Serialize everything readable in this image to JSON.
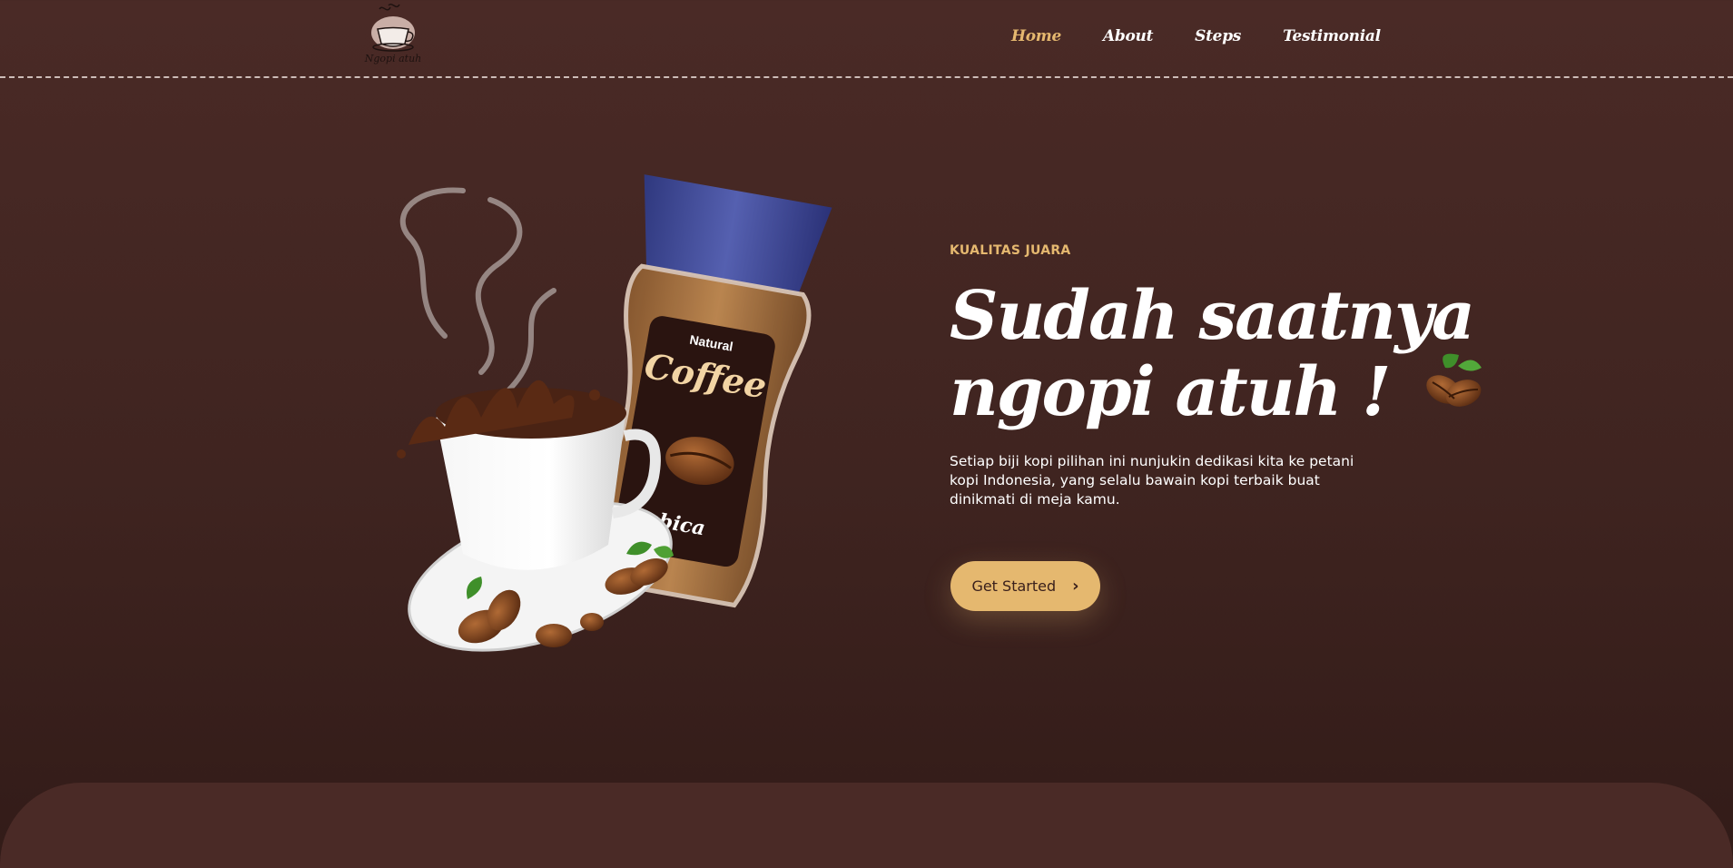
{
  "nav": {
    "logo_icon": "coffee-cup-logo",
    "logo_text": "Ngopi atuh",
    "links": [
      {
        "label": "Home",
        "active": true
      },
      {
        "label": "About",
        "active": false
      },
      {
        "label": "Steps",
        "active": false
      },
      {
        "label": "Testimonial",
        "active": false
      }
    ]
  },
  "hero": {
    "kicker": "KUALITAS JUARA",
    "headline_line1": "Sudah saatnya",
    "headline_line2": "ngopi atuh !",
    "description": "Setiap biji kopi pilihan ini nunjukin dedikasi kita ke petani kopi Indonesia, yang selalu bawain kopi terbaik buat dinikmati di meja kamu.",
    "cta_label": "Get Started",
    "cta_icon": "chevron-right-icon",
    "product_label_brand": "Natural",
    "product_label_name": "Coffee",
    "product_label_variant": "rabica"
  },
  "colors": {
    "background": "#4a2a26",
    "accent": "#e5b86f",
    "jar_lid": "#3f4896"
  }
}
